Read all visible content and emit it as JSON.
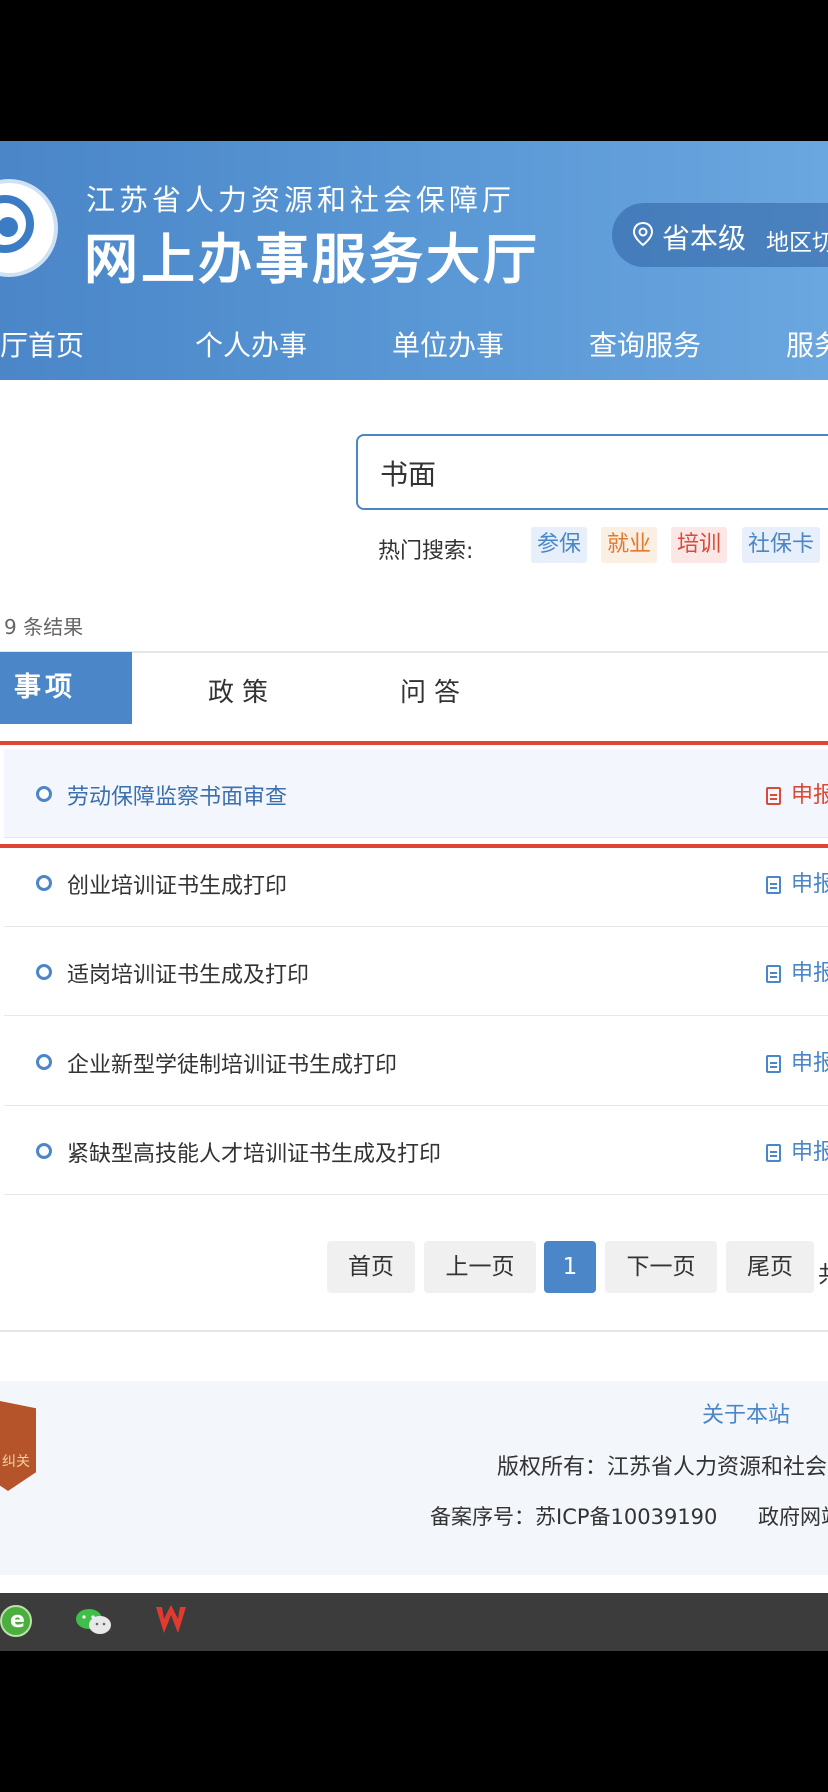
{
  "header": {
    "subtitle": "江苏省人力资源和社会保障厅",
    "title": "网上办事服务大厅",
    "region": "省本级",
    "region_switch": "地区切换"
  },
  "nav": {
    "items": [
      "厅首页",
      "个人办事",
      "单位办事",
      "查询服务",
      "服务"
    ]
  },
  "search": {
    "value": "书面",
    "hot_label": "热门搜索:",
    "hot_tags": [
      {
        "label": "参保",
        "color": "#4a86c8",
        "bg": "#e6effa"
      },
      {
        "label": "就业",
        "color": "#e07a2e",
        "bg": "#fbeee3"
      },
      {
        "label": "培训",
        "color": "#d94a38",
        "bg": "#fbe8e6"
      },
      {
        "label": "社保卡",
        "color": "#4a86c8",
        "bg": "#e6effa"
      }
    ]
  },
  "results": {
    "count_text": "9 条结果"
  },
  "tabs": {
    "active": "事项",
    "policy": "政策",
    "qa": "问答"
  },
  "list": {
    "apply_label": "申报",
    "items": [
      "劳动保障监察书面审查",
      "创业培训证书生成打印",
      "适岗培训证书生成及打印",
      "企业新型学徒制培训证书生成打印",
      "紧缺型高技能人才培训证书生成及打印"
    ]
  },
  "pagination": {
    "first": "首页",
    "prev": "上一页",
    "current": "1",
    "next": "下一页",
    "last": "尾页",
    "more": "共"
  },
  "footer": {
    "badge_text": "纠关",
    "about": "关于本站",
    "copyright": "版权所有：江苏省人力资源和社会",
    "icp": "备案序号：苏ICP备10039190",
    "gov": "政府网站"
  },
  "colors": {
    "brand": "#4a86c8",
    "highlight_border": "#e04434"
  }
}
